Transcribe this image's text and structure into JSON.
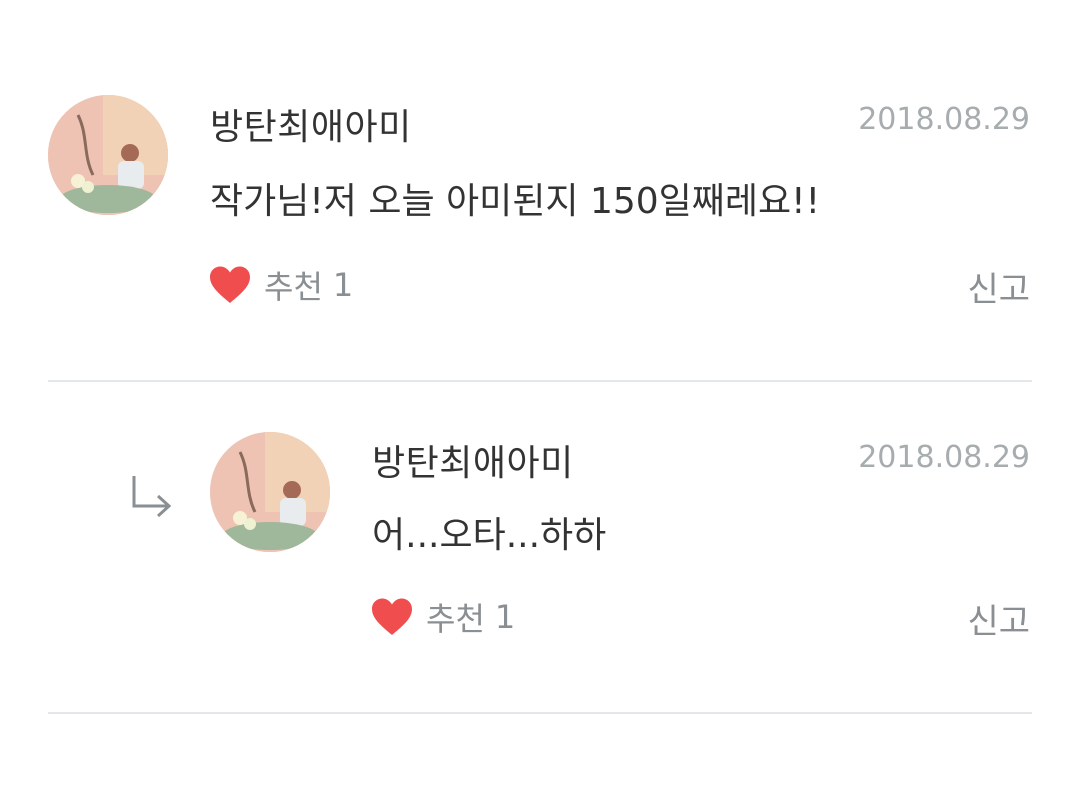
{
  "comments": [
    {
      "username": "방탄최애아미",
      "date": "2018.08.29",
      "message": "작가님!저 오늘 아미된지 150일째레요!!",
      "like_label": "추천",
      "like_count": "1",
      "report_label": "신고"
    }
  ],
  "replies": [
    {
      "username": "방탄최애아미",
      "date": "2018.08.29",
      "message": "어...오타...하하",
      "like_label": "추천",
      "like_count": "1",
      "report_label": "신고"
    }
  ],
  "icons": {
    "like": "heart-icon",
    "reply": "reply-arrow-icon"
  },
  "colors": {
    "heart": "#f04e4e",
    "divider": "#e4e7e9",
    "muted_text": "#8a8f93",
    "date_text": "#a7acaf"
  }
}
